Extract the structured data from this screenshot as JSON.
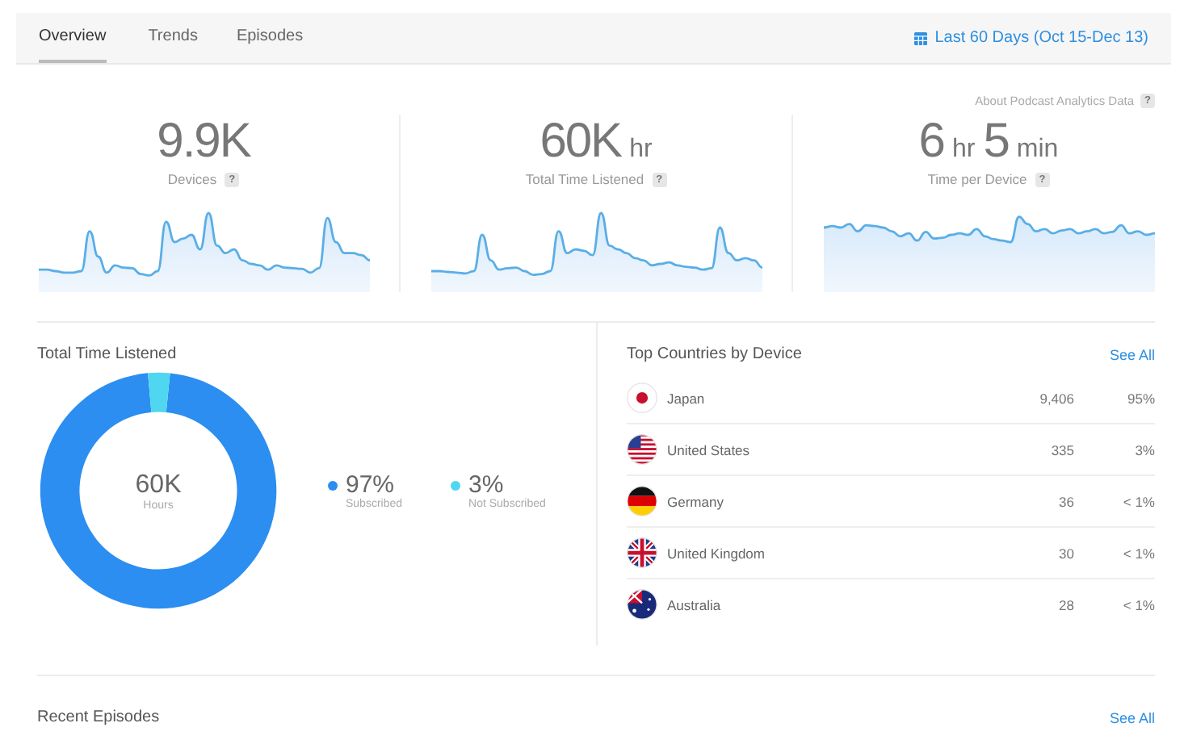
{
  "tabs": [
    {
      "label": "Overview",
      "selected": true
    },
    {
      "label": "Trends",
      "selected": false
    },
    {
      "label": "Episodes",
      "selected": false
    }
  ],
  "date_range": "Last 60 Days (Oct 15-Dec 13)",
  "about_link": "About Podcast Analytics Data",
  "help_mark": "?",
  "metrics": [
    {
      "parts": [
        {
          "kind": "number",
          "text": "9.9K"
        }
      ],
      "label": "Devices"
    },
    {
      "parts": [
        {
          "kind": "number",
          "text": "60K"
        },
        {
          "kind": "unit",
          "text": "hr"
        }
      ],
      "label": "Total Time Listened"
    },
    {
      "parts": [
        {
          "kind": "number",
          "text": "6"
        },
        {
          "kind": "unit",
          "text": "hr"
        },
        {
          "kind": "number",
          "text": "5"
        },
        {
          "kind": "unit",
          "text": "min"
        }
      ],
      "label": "Time per Device"
    }
  ],
  "total_time": {
    "title": "Total Time Listened",
    "center_value": "60K",
    "center_label": "Hours",
    "chart_data": {
      "type": "donut",
      "values": [
        97,
        3
      ]
    },
    "legend": [
      {
        "value": "97%",
        "label": "Subscribed",
        "color": "#2b8ef0"
      },
      {
        "value": "3%",
        "label": "Not Subscribed",
        "color": "#4fd6f0"
      }
    ]
  },
  "countries": {
    "title": "Top Countries by Device",
    "see_all": "See All",
    "rows": [
      {
        "kind": "jp",
        "name": "Japan",
        "devices": "9,406",
        "share": "95%"
      },
      {
        "kind": "us",
        "name": "United States",
        "devices": "335",
        "share": "3%"
      },
      {
        "kind": "de",
        "name": "Germany",
        "devices": "36",
        "share": "< 1%"
      },
      {
        "kind": "gb",
        "name": "United Kingdom",
        "devices": "30",
        "share": "< 1%"
      },
      {
        "kind": "au",
        "name": "Australia",
        "devices": "28",
        "share": "< 1%"
      }
    ]
  },
  "recent": {
    "title": "Recent Episodes",
    "see_all": "See All"
  }
}
